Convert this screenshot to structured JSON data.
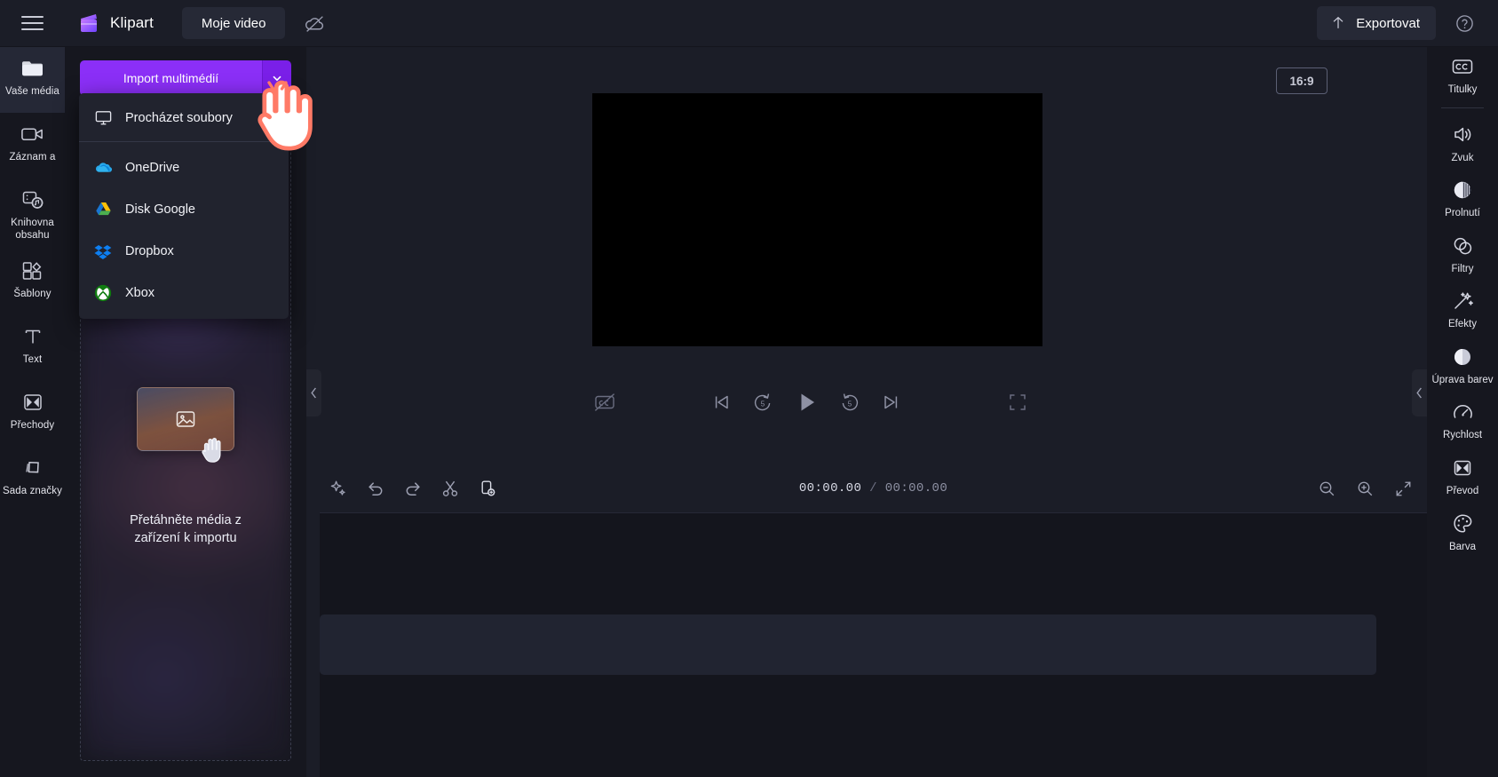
{
  "app": {
    "brand_name": "Klipart",
    "project_name": "Moje video",
    "menu_icon": "hamburger-icon",
    "cloud_icon": "cloud-off-icon",
    "export_label": "Exportovat",
    "export_icon": "upload-icon",
    "help_icon": "question-circle-icon"
  },
  "left_rail": {
    "items": [
      {
        "label": "Vaše média",
        "icon": "folder-icon",
        "active": true
      },
      {
        "label": "Záznam a",
        "icon": "video-camera-icon",
        "active": false
      },
      {
        "label": "Knihovna obsahu",
        "icon": "content-library-icon",
        "active": false
      },
      {
        "label": "Šablony",
        "icon": "templates-icon",
        "active": false
      },
      {
        "label": "Text",
        "icon": "text-t-icon",
        "active": false
      },
      {
        "label": "Přechody",
        "icon": "transitions-icon",
        "active": false
      },
      {
        "label": "Sada značky",
        "icon": "brand-kit-icon",
        "active": false
      }
    ]
  },
  "media_panel": {
    "import_button_label": "Import multimédií",
    "import_caret_icon": "chevron-down-icon",
    "dropzone_text": "Přetáhněte média z\nzařízení k importu",
    "dropzone_card_icon": "image-placeholder-icon",
    "dropzone_hand_icon": "drag-hand-icon"
  },
  "import_dropdown": {
    "items": [
      {
        "label": "Procházet soubory",
        "icon": "monitor-icon"
      },
      {
        "label": "OneDrive",
        "icon": "onedrive-icon"
      },
      {
        "label": "Disk Google",
        "icon": "google-drive-icon"
      },
      {
        "label": "Dropbox",
        "icon": "dropbox-icon"
      },
      {
        "label": "Xbox",
        "icon": "xbox-icon"
      }
    ]
  },
  "preview": {
    "aspect_ratio": "16:9",
    "collapse_left_icon": "chevron-left-icon",
    "collapse_right_icon": "chevron-left-icon",
    "controls": {
      "captions_icon": "captions-off-icon",
      "skip_start_icon": "skip-to-start-icon",
      "back5_icon": "rewind-5-icon",
      "play_icon": "play-icon",
      "forward5_icon": "forward-5-icon",
      "skip_end_icon": "skip-to-end-icon",
      "fullscreen_icon": "fullscreen-icon"
    }
  },
  "timeline_toolbar": {
    "tools": [
      {
        "icon": "magic-sparkle-icon",
        "name": "auto-compose"
      },
      {
        "icon": "undo-icon",
        "name": "undo"
      },
      {
        "icon": "redo-icon",
        "name": "redo"
      },
      {
        "icon": "scissors-icon",
        "name": "split"
      },
      {
        "icon": "duplicate-icon",
        "name": "duplicate"
      }
    ],
    "current_time": "00:00.00",
    "separator": "/",
    "total_time": "00:00.00",
    "zoom_out_icon": "zoom-out-icon",
    "zoom_in_icon": "zoom-in-icon",
    "fit_icon": "fit-to-screen-icon"
  },
  "right_rail": {
    "top_item": {
      "label": "Titulky",
      "icon": "closed-captions-icon"
    },
    "items": [
      {
        "label": "Zvuk",
        "icon": "speaker-icon"
      },
      {
        "label": "Prolnutí",
        "icon": "fade-icon"
      },
      {
        "label": "Filtry",
        "icon": "filters-icon"
      },
      {
        "label": "Efekty",
        "icon": "effects-wand-icon"
      },
      {
        "label": "Úprava barev",
        "icon": "color-adjust-icon"
      },
      {
        "label": "Rychlost",
        "icon": "speed-gauge-icon"
      },
      {
        "label": "Převod",
        "icon": "transition-convert-icon"
      },
      {
        "label": "Barva",
        "icon": "color-palette-icon"
      }
    ]
  },
  "colors": {
    "accent_purple": "#8b2ff7",
    "accent_purple_dark": "#7a1fe8",
    "bg_dark": "#16171f",
    "bg_panel": "#1b1d27",
    "bg_timeline": "#14151d",
    "cursor_orange": "#ff7a66"
  }
}
